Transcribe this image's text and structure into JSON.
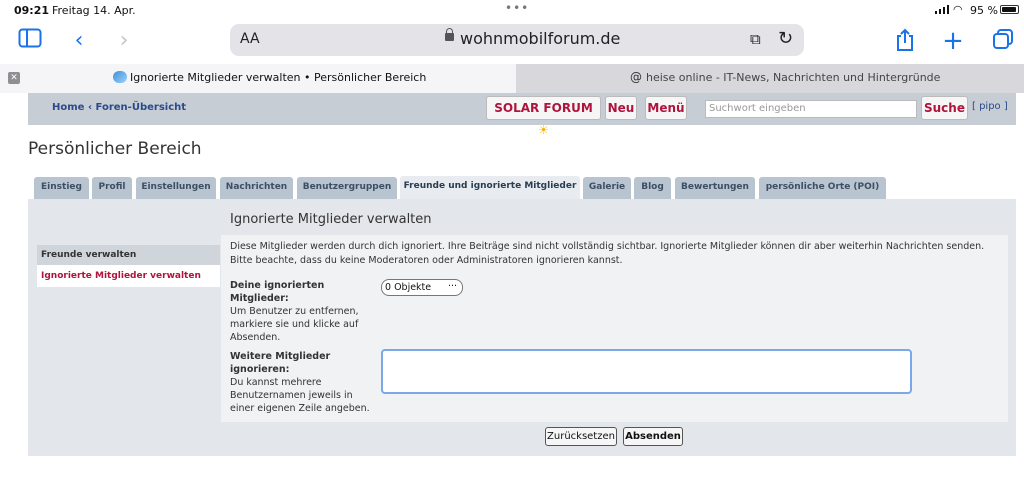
{
  "status": {
    "time": "09:21",
    "date": "Freitag 14. Apr.",
    "battery": "95 %",
    "battery_level": 0.95
  },
  "toolbar": {
    "text_size": "AA",
    "url": "wohnmobilforum.de"
  },
  "tabs": [
    {
      "title": "Ignorierte Mitglieder verwalten • Persönlicher Bereich"
    },
    {
      "title": "heise online - IT-News, Nachrichten und Hintergründe"
    }
  ],
  "forum": {
    "breadcrumb_home": "Home",
    "breadcrumb_sep": "‹",
    "breadcrumb_index": "Foren-Übersicht",
    "solar_button": "SOLAR FORUM",
    "new_button": "Neu",
    "menu_button": "Menü",
    "search_placeholder": "Suchwort eingeben",
    "search_button": "Suche",
    "user_label": "[ pipo ]"
  },
  "page_title": "Persönlicher Bereich",
  "main_tabs": [
    "Einstieg",
    "Profil",
    "Einstellungen",
    "Nachrichten",
    "Benutzergruppen",
    "Freunde und ignorierte Mitglieder",
    "Galerie",
    "Blog",
    "Bewertungen",
    "persönliche Orte (POI)"
  ],
  "subnav": {
    "section": "Freunde verwalten",
    "active_item": "Ignorierte Mitglieder verwalten"
  },
  "content": {
    "title": "Ignorierte Mitglieder verwalten",
    "description": "Diese Mitglieder werden durch dich ignoriert. Ihre Beiträge sind nicht vollständig sichtbar. Ignorierte Mitglieder können dir aber weiterhin Nachrichten senden. Bitte beachte, dass du keine Moderatoren oder Administratoren ignorieren kannst.",
    "ignored_label": "Deine ignorierten Mitglieder:",
    "ignored_help": "Um Benutzer zu entfernen, markiere sie und klicke auf Absenden.",
    "ignored_select_value": "0 Objekte",
    "more_label": "Weitere Mitglieder ignorieren:",
    "more_help": "Du kannst mehrere Benutzernamen jeweils in einer eigenen Zeile angeben.",
    "more_value": "",
    "reset_button": "Zurücksetzen",
    "submit_button": "Absenden"
  }
}
